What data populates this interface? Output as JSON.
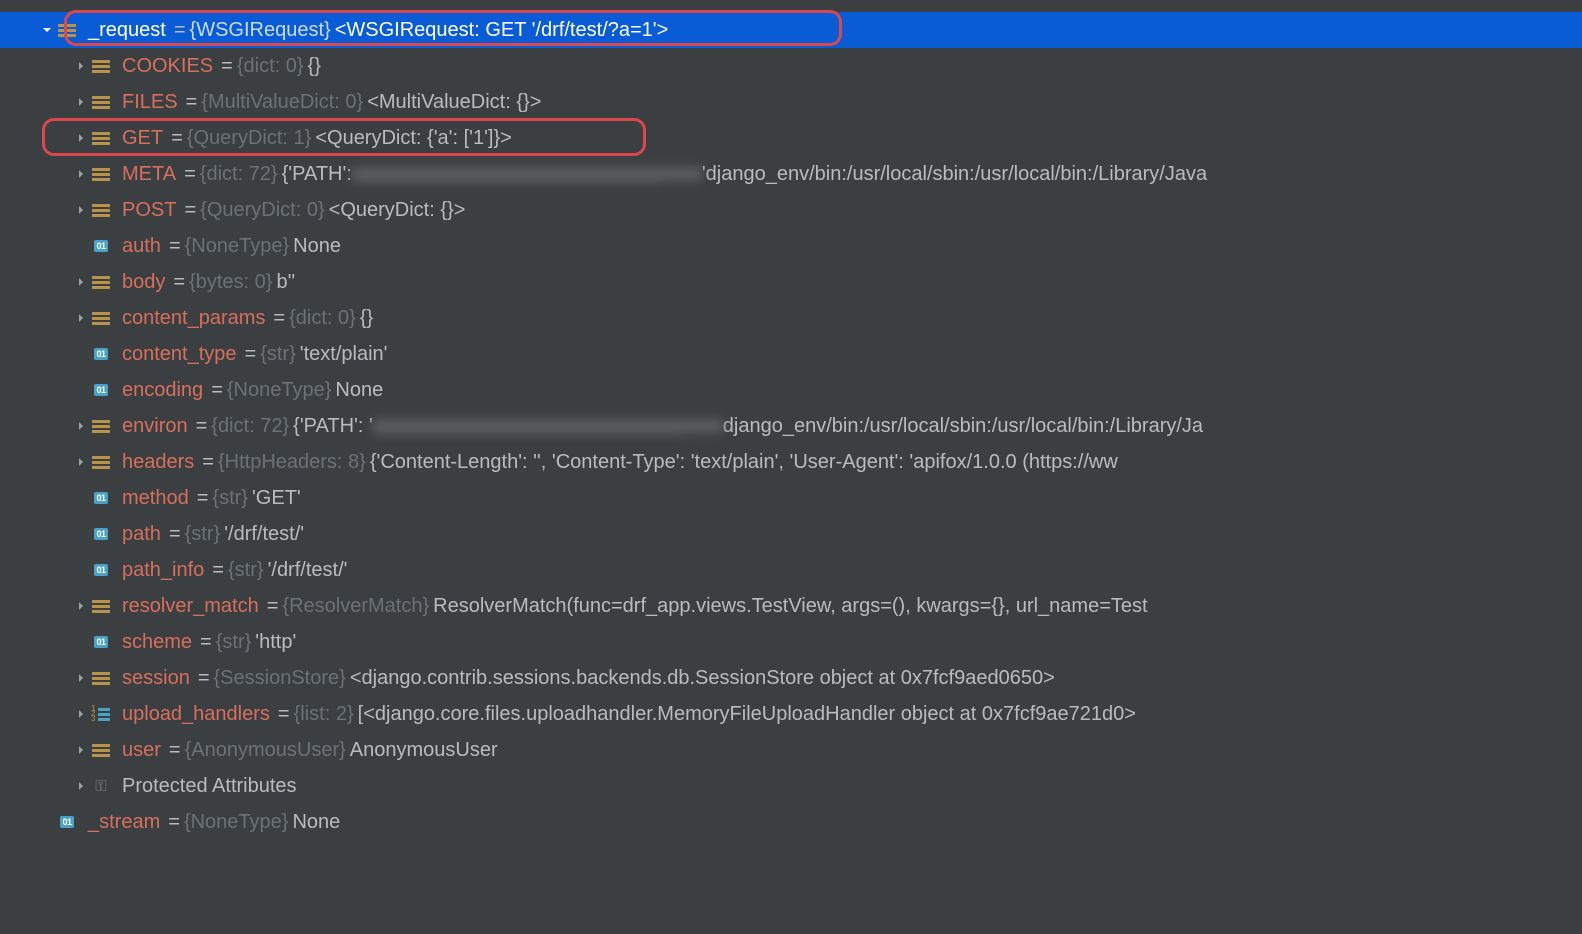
{
  "root": {
    "name": "_request",
    "type": "{WSGIRequest}",
    "value": "<WSGIRequest: GET '/drf/test/?a=1'>"
  },
  "rows": [
    {
      "name": "COOKIES",
      "type": "{dict: 0}",
      "value": "{}",
      "icon": "dict",
      "arrow": true
    },
    {
      "name": "FILES",
      "type": "{MultiValueDict: 0}",
      "value": "<MultiValueDict: {}>",
      "icon": "dict",
      "arrow": true
    },
    {
      "name": "GET",
      "type": "{QueryDict: 1}",
      "value": "<QueryDict: {'a': ['1']}>",
      "icon": "dict",
      "arrow": true
    },
    {
      "name": "META",
      "type": "{dict: 72}",
      "value_prefix": "{'PATH': ",
      "value_suffix": "'django_env/bin:/usr/local/sbin:/usr/local/bin:/Library/Java",
      "icon": "dict",
      "arrow": true,
      "blur": true
    },
    {
      "name": "POST",
      "type": "{QueryDict: 0}",
      "value": "<QueryDict: {}>",
      "icon": "dict",
      "arrow": true
    },
    {
      "name": "auth",
      "type": "{NoneType}",
      "value": "None",
      "icon": "prim",
      "arrow": false
    },
    {
      "name": "body",
      "type": "{bytes: 0}",
      "value": "b''",
      "icon": "dict",
      "arrow": true
    },
    {
      "name": "content_params",
      "type": "{dict: 0}",
      "value": "{}",
      "icon": "dict",
      "arrow": true
    },
    {
      "name": "content_type",
      "type": "{str}",
      "value": "'text/plain'",
      "icon": "prim",
      "arrow": false
    },
    {
      "name": "encoding",
      "type": "{NoneType}",
      "value": "None",
      "icon": "prim",
      "arrow": false
    },
    {
      "name": "environ",
      "type": "{dict: 72}",
      "value_prefix": "{'PATH': '",
      "value_suffix": "django_env/bin:/usr/local/sbin:/usr/local/bin:/Library/Ja",
      "icon": "dict",
      "arrow": true,
      "blur": true
    },
    {
      "name": "headers",
      "type": "{HttpHeaders: 8}",
      "value": "{'Content-Length': '', 'Content-Type': 'text/plain', 'User-Agent': 'apifox/1.0.0 (https://ww",
      "icon": "dict",
      "arrow": true
    },
    {
      "name": "method",
      "type": "{str}",
      "value": "'GET'",
      "icon": "prim",
      "arrow": false
    },
    {
      "name": "path",
      "type": "{str}",
      "value": "'/drf/test/'",
      "icon": "prim",
      "arrow": false
    },
    {
      "name": "path_info",
      "type": "{str}",
      "value": "'/drf/test/'",
      "icon": "prim",
      "arrow": false
    },
    {
      "name": "resolver_match",
      "type": "{ResolverMatch}",
      "value": "ResolverMatch(func=drf_app.views.TestView, args=(), kwargs={}, url_name=Test",
      "icon": "dict",
      "arrow": true
    },
    {
      "name": "scheme",
      "type": "{str}",
      "value": "'http'",
      "icon": "prim",
      "arrow": false
    },
    {
      "name": "session",
      "type": "{SessionStore}",
      "value": "<django.contrib.sessions.backends.db.SessionStore object at 0x7fcf9aed0650>",
      "icon": "dict",
      "arrow": true
    },
    {
      "name": "upload_handlers",
      "type": "{list: 2}",
      "value": "[<django.core.files.uploadhandler.MemoryFileUploadHandler object at 0x7fcf9ae721d0>",
      "icon": "list",
      "arrow": true
    },
    {
      "name": "user",
      "type": "{AnonymousUser}",
      "value": "AnonymousUser",
      "icon": "dict",
      "arrow": true
    },
    {
      "name": "Protected Attributes",
      "type": "",
      "value": "",
      "icon": "key",
      "arrow": true,
      "special": true
    }
  ],
  "stream": {
    "name": "_stream",
    "type": "{NoneType}",
    "value": "None"
  }
}
